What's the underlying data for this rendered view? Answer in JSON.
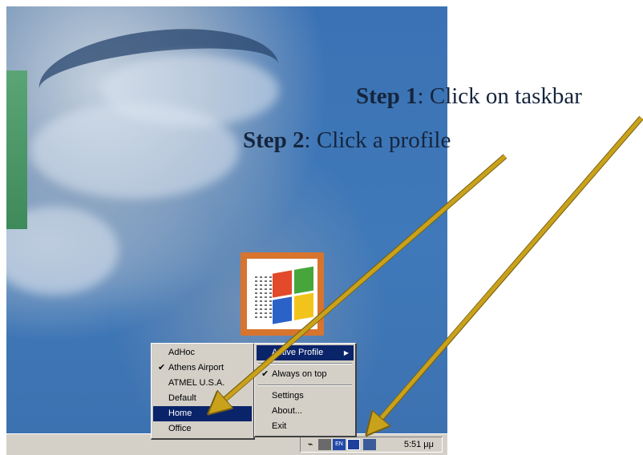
{
  "steps": [
    {
      "label": "Step 1",
      "text": ": Click on taskbar"
    },
    {
      "label": "Step 2",
      "text": ": Click a profile"
    }
  ],
  "profiles_menu": {
    "items": [
      {
        "label": "AdHoc",
        "checked": false,
        "selected": false
      },
      {
        "label": "Athens Airport",
        "checked": true,
        "selected": false
      },
      {
        "label": "ATMEL U.S.A.",
        "checked": false,
        "selected": false
      },
      {
        "label": "Default",
        "checked": false,
        "selected": false
      },
      {
        "label": "Home",
        "checked": false,
        "selected": true
      },
      {
        "label": "Office",
        "checked": false,
        "selected": false
      }
    ]
  },
  "main_menu": {
    "active_profile": "Active Profile",
    "always_on_top": "Always on top",
    "settings": "Settings",
    "about": "About...",
    "exit": "Exit"
  },
  "taskbar": {
    "clock": "5:51 μμ",
    "tray_icons": [
      "network-icon",
      "monitor-icon",
      "language-icon",
      "profile-tray-icon",
      "computer-icon"
    ]
  },
  "colors": {
    "menu_bg": "#d4d0c8",
    "highlight": "#0a246a",
    "arrow": "#c9a21b",
    "desktop": "#3b72b5"
  }
}
